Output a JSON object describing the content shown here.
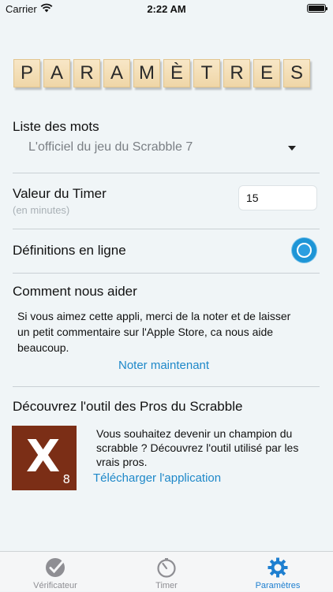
{
  "status_bar": {
    "carrier": "Carrier",
    "time": "2:22 AM"
  },
  "title_tiles": [
    "P",
    "A",
    "R",
    "A",
    "M",
    "È",
    "T",
    "R",
    "E",
    "S"
  ],
  "word_list": {
    "label": "Liste des mots",
    "selected": "L'officiel du jeu du Scrabble 7"
  },
  "timer": {
    "label": "Valeur du Timer",
    "sublabel": "(en minutes)",
    "value": "15"
  },
  "definitions": {
    "label": "Définitions en ligne",
    "enabled": true
  },
  "help": {
    "title": "Comment nous aider",
    "text": "Si vous aimez cette appli, merci de la noter et de laisser un petit commentaire sur l'Apple Store, ca nous aide beaucoup.",
    "rate_link": "Noter maintenant"
  },
  "promo": {
    "title": "Découvrez l'outil des Pros du Scrabble",
    "logo_letter": "X",
    "logo_points": "8",
    "text": "Vous souhaitez devenir un champion du scrabble ? Découvrez l'outil utilisé par les vrais pros.",
    "download_link": "Télécharger l'application"
  },
  "tabs": [
    {
      "label": "Vérificateur",
      "icon": "checkmark-circle-icon",
      "active": false
    },
    {
      "label": "Timer",
      "icon": "stopwatch-icon",
      "active": false
    },
    {
      "label": "Paramètres",
      "icon": "gear-icon",
      "active": true
    }
  ],
  "colors": {
    "background": "#f0f5f7",
    "accent": "#1e88c9",
    "tile": "#f3ddb2",
    "logo": "#7b2e16"
  }
}
